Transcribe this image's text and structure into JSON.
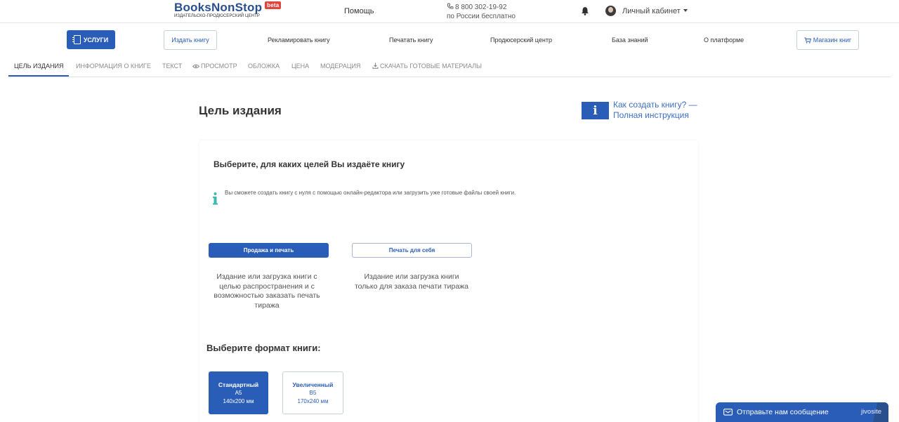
{
  "header": {
    "logo_main": "BooksNonStop",
    "logo_badge": "beta",
    "logo_sub": "издательско-продюсерский центр",
    "help": "Помощь",
    "phone_number": "8 800 302-19-92",
    "phone_note": "по России бесплатно",
    "cabinet_label": "Личный кабинет"
  },
  "nav": {
    "services": "УСЛУГИ",
    "publish": "Издать книгу",
    "advertise": "Рекламировать книгу",
    "print": "Печатать книгу",
    "producer": "Продюсерский центр",
    "knowledge": "База знаний",
    "about": "О платформе",
    "shop": "Магазин книг"
  },
  "tabs": {
    "goal": "ЦЕЛЬ ИЗДАНИЯ",
    "info": "ИНФОРМАЦИЯ О КНИГЕ",
    "text": "ТЕКСТ",
    "preview": "ПРОСМОТР",
    "cover": "ОБЛОЖКА",
    "price": "ЦЕНА",
    "moderation": "МОДЕРАЦИЯ",
    "download": "СКАЧАТЬ ГОТОВЫЕ МАТЕРИАЛЫ"
  },
  "main": {
    "title": "Цель издания",
    "info_letter": "i",
    "info_link_line1": "Как создать книгу? —",
    "info_link_line2": "Полная инструкция",
    "card_heading": "Выберите, для каких целей Вы издаёте книгу",
    "hint": "Вы сможете создать книгу с нуля с помощью онлайн-редактора или загрузить уже готовые файлы своей книги.",
    "goal_sale_label": "Продажа и печать",
    "goal_sale_desc": [
      "Издание или загрузка книги с",
      "целью распространения и с",
      "возможностью заказать печать",
      "тиража"
    ],
    "goal_self_label": "Печать для себя",
    "goal_self_desc": [
      "Издание или загрузка книги",
      "только для заказа печати тиража"
    ],
    "format_heading": "Выберите формат книги:",
    "formats": [
      {
        "name": "Стандартный",
        "code": "A5",
        "size": "140x200 мм"
      },
      {
        "name": "Увеличенный",
        "code": "B5",
        "size": "170x240 мм"
      }
    ]
  },
  "chat": {
    "label": "Отправьте нам сообщение",
    "brand": "jivosite"
  },
  "colors": {
    "accent": "#2a5db8",
    "logo": "#2a4f8f",
    "badge": "#e0463c"
  }
}
